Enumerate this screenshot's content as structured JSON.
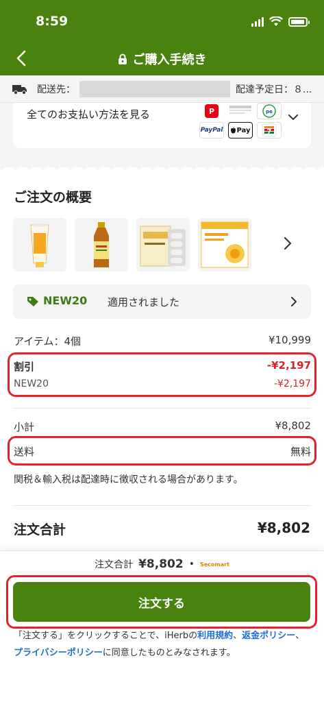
{
  "status": {
    "time": "8:59"
  },
  "nav": {
    "title": "ご購入手続き"
  },
  "shipping": {
    "label": "配送先：",
    "delivery_label": "配達予定日：８..."
  },
  "payment": {
    "see_all": "全てのお支払い方法を見る",
    "logos": [
      "paypay-logo",
      "konbini-logo",
      "pay-easy-logo",
      "PayPal",
      "Pay",
      "seven-eleven-logo"
    ]
  },
  "summary": {
    "title": "ご注文の概要",
    "products": [
      "sunscreen-tube",
      "apple-cider-vinegar-bottle",
      "lactobif-probiotics-box",
      "sunlipid-vitamin-c-box"
    ]
  },
  "promo": {
    "code": "NEW20",
    "applied_text": "適用されました"
  },
  "lines": {
    "items_label": "アイテム：4個",
    "items_value": "¥10,999",
    "discount_label": "割引",
    "discount_value": "-¥2,197",
    "discount_code": "NEW20",
    "discount_code_value": "-¥2,197",
    "subtotal_label": "小計",
    "subtotal_value": "¥8,802",
    "shipping_label": "送料",
    "shipping_value": "無料"
  },
  "note": "関税＆輸入税は配達時に徴収される場合があります。",
  "total": {
    "label": "注文合計",
    "value": "¥8,802"
  },
  "bottom": {
    "mini_label": "注文合計",
    "mini_value": "¥8,802",
    "mini_brand": "Secomart",
    "order_button": "注文する",
    "terms_prefix": "「注文する」をクリックすることで、iHerbの",
    "link_terms": "利用規約",
    "sep1": "、",
    "link_refund": "返金ポリシー",
    "sep2": "、",
    "link_privacy": "プライバシーポリシー",
    "terms_suffix": "に同意したものとみなされます。"
  },
  "colors": {
    "brand_green": "#4a820f",
    "discount_red": "#d3232b",
    "highlight_red": "#e8202a",
    "link_blue": "#1f6fd1"
  }
}
